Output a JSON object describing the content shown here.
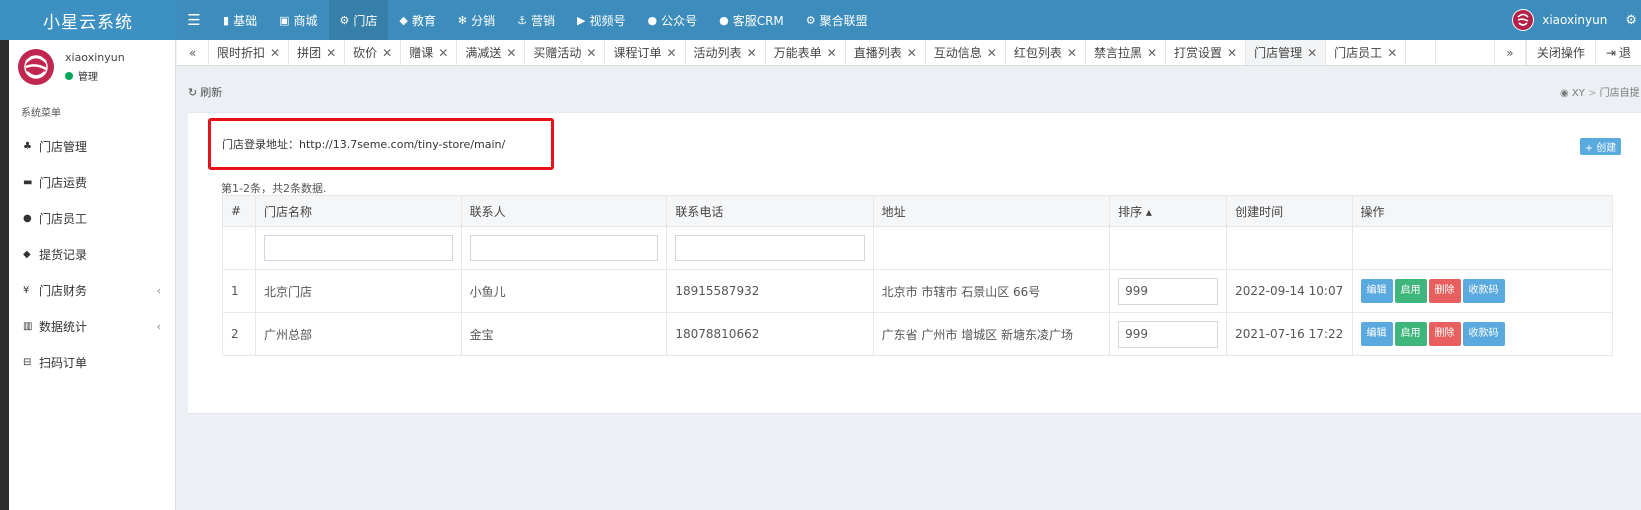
{
  "app": {
    "title": "小星云系统"
  },
  "topnav": [
    {
      "icon": "bookmark-icon",
      "glyph": "▮",
      "label": "基础"
    },
    {
      "icon": "shopping-bag-icon",
      "glyph": "▣",
      "label": "商城"
    },
    {
      "icon": "store-icon",
      "glyph": "⚙",
      "label": "门店"
    },
    {
      "icon": "graduation-cap-icon",
      "glyph": "◆",
      "label": "教育"
    },
    {
      "icon": "snowflake-icon",
      "glyph": "✻",
      "label": "分销"
    },
    {
      "icon": "anchor-icon",
      "glyph": "⚓",
      "label": "营销"
    },
    {
      "icon": "video-icon",
      "glyph": "▶",
      "label": "视频号"
    },
    {
      "icon": "wechat-icon",
      "glyph": "●",
      "label": "公众号"
    },
    {
      "icon": "chat-icon",
      "glyph": "●",
      "label": "客服CRM"
    },
    {
      "icon": "union-icon",
      "glyph": "⚙",
      "label": "聚合联盟"
    }
  ],
  "user": {
    "name": "xiaoxinyun",
    "role": "管理"
  },
  "sidebar": {
    "header": "系统菜单",
    "items": [
      {
        "icon": "sitemap-icon",
        "glyph": "♣",
        "label": "门店管理"
      },
      {
        "icon": "truck-icon",
        "glyph": "▬",
        "label": "门店运费"
      },
      {
        "icon": "users-icon",
        "glyph": "●",
        "label": "门店员工"
      },
      {
        "icon": "tag-icon",
        "glyph": "◆",
        "label": "提货记录"
      },
      {
        "icon": "yen-icon",
        "glyph": "¥",
        "label": "门店财务"
      },
      {
        "icon": "bar-chart-icon",
        "glyph": "▥",
        "label": "数据统计"
      },
      {
        "icon": "minus-square-icon",
        "glyph": "⊟",
        "label": "扫码订单"
      }
    ]
  },
  "tabs": [
    "限时折扣",
    "拼团",
    "砍价",
    "赠课",
    "满减送",
    "买赠活动",
    "课程订单",
    "活动列表",
    "万能表单",
    "直播列表",
    "互动信息",
    "红包列表",
    "禁言拉黑",
    "打赏设置",
    "门店管理",
    "门店员工"
  ],
  "tabs_ops": {
    "prev": "«",
    "next": "»",
    "close_ops": "关闭操作",
    "logout": "退"
  },
  "page": {
    "refresh": "刷新",
    "breadcrumb_home": "XY",
    "breadcrumb_current": "门店自提",
    "login_url": "门店登录地址：http://13.7seme.com/tiny-store/main/",
    "create": "+ 创建",
    "summary": "第1-2条，共2条数据."
  },
  "table": {
    "columns": [
      "#",
      "门店名称",
      "联系人",
      "联系电话",
      "地址",
      "排序 ▴",
      "创建时间",
      "操作"
    ],
    "rows": [
      {
        "no": "1",
        "name": "北京门店",
        "contact": "小鱼儿",
        "phone": "18915587932",
        "address": "北京市 市辖市 石景山区 66号",
        "sort": "999",
        "created": "2022-09-14 10:07"
      },
      {
        "no": "2",
        "name": "广州总部",
        "contact": "金宝",
        "phone": "18078810662",
        "address": "广东省 广州市 增城区 新塘东凌广场",
        "sort": "999",
        "created": "2021-07-16 17:22"
      }
    ],
    "actions": {
      "edit": "编辑",
      "enable": "启用",
      "delete": "删除",
      "pay_code": "收款码"
    }
  },
  "colors": {
    "topbar": "#3c8dbc",
    "highlight": "#e8101b",
    "edit": "#5aa9df",
    "enable": "#3fb67b",
    "delete": "#e85f5f"
  }
}
